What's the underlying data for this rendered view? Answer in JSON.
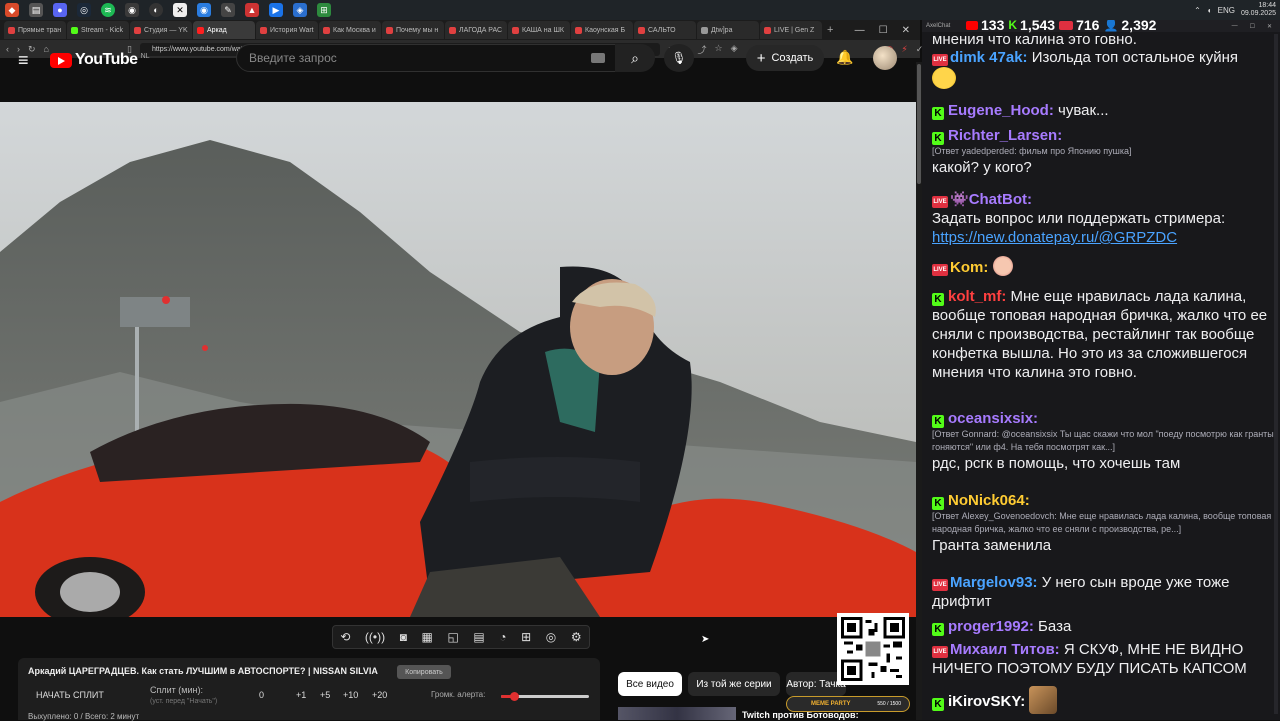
{
  "taskbar": {
    "icons": [
      "browser-icon",
      "file-icon",
      "discord-icon",
      "steam-icon",
      "spotify-icon",
      "app-icon",
      "obs-icon",
      "cross-icon",
      "browser-icon",
      "edit-icon",
      "app-icon",
      "media-icon",
      "app-icon",
      "app-icon"
    ],
    "lang": "ENG",
    "time": "18:44",
    "date": "09.09.2025"
  },
  "browser": {
    "tabs": [
      {
        "label": "Прямые тран",
        "color": "#e04040"
      },
      {
        "label": "Stream - Kick",
        "color": "#53fc18"
      },
      {
        "label": "Студия — YK",
        "color": "#e04040"
      },
      {
        "label": "Аркад",
        "color": "#ff2020"
      },
      {
        "label": "История Wart",
        "color": "#e04040"
      },
      {
        "label": "Как Москва и",
        "color": "#e04040"
      },
      {
        "label": "Почему мы н",
        "color": "#e04040"
      },
      {
        "label": "ЛАГОДА РАС",
        "color": "#e04040"
      },
      {
        "label": "КАША на ШК",
        "color": "#e04040"
      },
      {
        "label": "Каоунская Б",
        "color": "#e04040"
      },
      {
        "label": "САЛЬТО",
        "color": "#e04040"
      },
      {
        "label": "Дtw]ра",
        "color": "#999999"
      },
      {
        "label": "LIVE | Gen Z",
        "color": "#e04040"
      }
    ],
    "url": "https://www.youtube.com/watch?v=79dAKd3pk8o"
  },
  "youtube": {
    "logo_text": "YouTube",
    "region": "NL",
    "search_placeholder": "Введите запрос",
    "create_label": "Создать",
    "video_title": "Аркадий ЦАРЕГРАДЦЕВ. Как стать ЛУЧШИМ в АВТОСПОРТЕ? | NISSAN SILVIA",
    "copy_label": "Копировать",
    "split_start": "НАЧАТЬ СПЛИТ",
    "split_label": "Сплит (мин):",
    "split_sub": "(уст. перед \"Начать\")",
    "split_values": [
      "0",
      "+1",
      "+5",
      "+10",
      "+20"
    ],
    "alert_volume_label": "Громк. алерта:",
    "alert_volume": 0.15,
    "panel_bottom": "Выхуплено: 0 / Всего: 2 минут",
    "chips": [
      "Все видео",
      "Из той же серии",
      "Автор: Тачка"
    ],
    "rec_title": "Twitch против Ботоводов:"
  },
  "meme_widget": {
    "label": "MEME PARTY",
    "count": "550 / 1500"
  },
  "chat": {
    "app_name": "AxelChat",
    "stats": {
      "youtube": "133",
      "kick": "1,543",
      "live": "716",
      "viewers": "2,392"
    },
    "messages": [
      {
        "badge": "",
        "name": "",
        "color": "#efeff1",
        "reply": "",
        "text": "мнения что калина это говно."
      },
      {
        "badge": "live",
        "name": "dimk 47ak:",
        "color": "#4aa3ff",
        "reply": "",
        "text": "Изольда топ остальное куйня"
      },
      {
        "badge": "k",
        "name": "Eugene_Hood:",
        "color": "#a77bff",
        "reply": "",
        "text": "чувак..."
      },
      {
        "badge": "k",
        "name": "Richter_Larsen:",
        "color": "#a77bff",
        "reply": "[Ответ yadedperded: фильм про Японию пушка]",
        "text": "какой? у кого?"
      },
      {
        "badge": "live",
        "name": "ChatBot:",
        "color": "#a77bff",
        "reply": "",
        "text": "Задать вопрос или поддержать стримера:",
        "link": "https://new.donatepay.ru/@GRPZDC"
      },
      {
        "badge": "live",
        "name": "Kom:",
        "color": "#ffcc33",
        "reply": "",
        "text": ""
      },
      {
        "badge": "k",
        "name": "kolt_mf:",
        "color": "#ff4040",
        "reply": "",
        "text": "Мне еще нравилась лада калина, вообще топовая народная бричка, жалко что ее сняли с производства, рестайлинг так вообще конфетка вышла. Но это из за сложившегося мнения что калина это говно."
      },
      {
        "badge": "k",
        "name": "oceansixsix:",
        "color": "#a77bff",
        "reply": "[Ответ Gonnard: @oceansixsix Ты щас скажи что мол \"поеду посмотрю как гранты гоняются\" или ф4. На тебя посмотрят как...]",
        "text": "рдс, рсгк в помощь, что хочешь там"
      },
      {
        "badge": "k",
        "name": "NoNick064:",
        "color": "#ffcc33",
        "reply": "[Ответ Alexey_Govenoedovch: Мне еще нравилась лада калина, вообще топовая народная бричка, жалко что ее сняли с производства, ре...]",
        "text": "Гранта заменила"
      },
      {
        "badge": "live",
        "name": "Margelov93:",
        "color": "#4aa3ff",
        "reply": "",
        "text": "У него сын вроде уже тоже дрифтит"
      },
      {
        "badge": "k",
        "name": "proger1992:",
        "color": "#a77bff",
        "reply": "",
        "text": "База"
      },
      {
        "badge": "live",
        "name": "Михаил Титов:",
        "color": "#a77bff",
        "reply": "",
        "text": "Я СКУФ, МНЕ НЕ ВИДНО НИЧЕГО ПОЭТОМУ БУДУ ПИСАТЬ КАПСОМ"
      },
      {
        "badge": "k",
        "name": "iKirovSKY:",
        "color": "#ffffff",
        "reply": "",
        "text": ""
      }
    ]
  }
}
